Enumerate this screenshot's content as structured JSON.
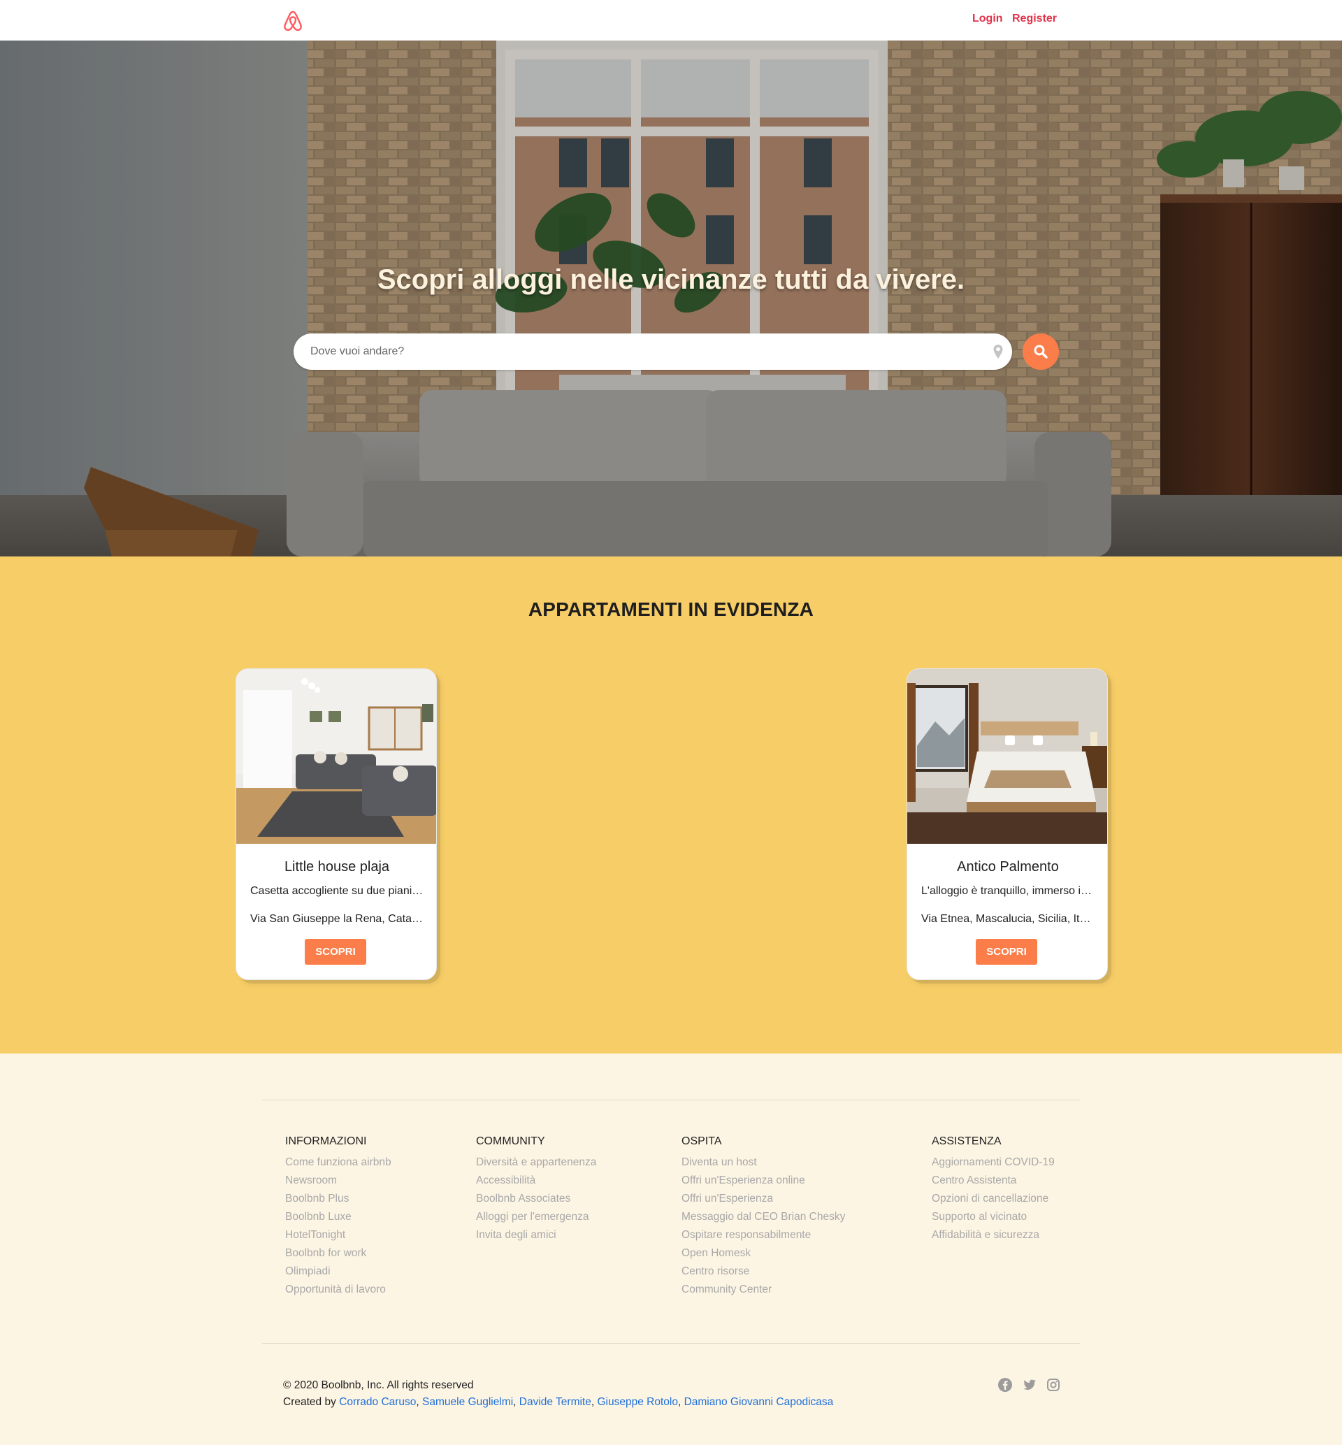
{
  "header": {
    "logo": "airbnb-logo",
    "login_label": "Login",
    "register_label": "Register",
    "link_color": "#e0324a"
  },
  "hero": {
    "title": "Scopri alloggi nelle vicinanze tutti da vivere.",
    "search_placeholder": "Dove vuoi andare?",
    "search_value": "",
    "pin_icon": "map-pin-icon",
    "search_icon": "search-icon",
    "accent_color": "#fb7e4a"
  },
  "featured": {
    "title": "APPARTAMENTI IN EVIDENZA",
    "background": "#f7cd67",
    "cards": [
      {
        "title": "Little house plaja",
        "description": "Casetta accogliente su due piani…",
        "address": "Via San Giuseppe la Rena, Cata…",
        "button": "SCOPRI"
      },
      {
        "title": "Antico Palmento",
        "description": "L'alloggio è tranquillo, immerso i…",
        "address": "Via Etnea, Mascalucia, Sicilia, It…",
        "button": "SCOPRI"
      }
    ]
  },
  "footer": {
    "columns": [
      {
        "heading": "INFORMAZIONI",
        "links": [
          "Come funziona airbnb",
          "Newsroom",
          "Boolbnb Plus",
          "Boolbnb Luxe",
          "HotelTonight",
          "Boolbnb for work",
          "Olimpiadi",
          "Opportunità di lavoro"
        ]
      },
      {
        "heading": "COMMUNITY",
        "links": [
          "Diversità e appartenenza",
          "Accessibilità",
          "Boolbnb Associates",
          "Alloggi per l'emergenza",
          "Invita degli amici"
        ]
      },
      {
        "heading": "OSPITA",
        "links": [
          "Diventa un host",
          "Offri un'Esperienza online",
          "Offri un'Esperienza",
          "Messaggio dal CEO Brian Chesky",
          "Ospitare responsabilmente",
          "Open Homesk",
          "Centro risorse",
          "Community Center"
        ]
      },
      {
        "heading": "ASSISTENZA",
        "links": [
          "Aggiornamenti COVID-19",
          "Centro Assistenta",
          "Opzioni di cancellazione",
          "Supporto al vicinato",
          "Affidabilità e sicurezza"
        ]
      }
    ],
    "copyright": "© 2020 Boolbnb, Inc. All rights reserved",
    "created_by_label": "Created by",
    "authors": [
      "Corrado Caruso",
      "Samuele Guglielmi",
      "Davide Termite",
      "Giuseppe Rotolo",
      "Damiano Giovanni Capodicasa"
    ],
    "social_icons": [
      "facebook-icon",
      "twitter-icon",
      "instagram-icon"
    ]
  }
}
